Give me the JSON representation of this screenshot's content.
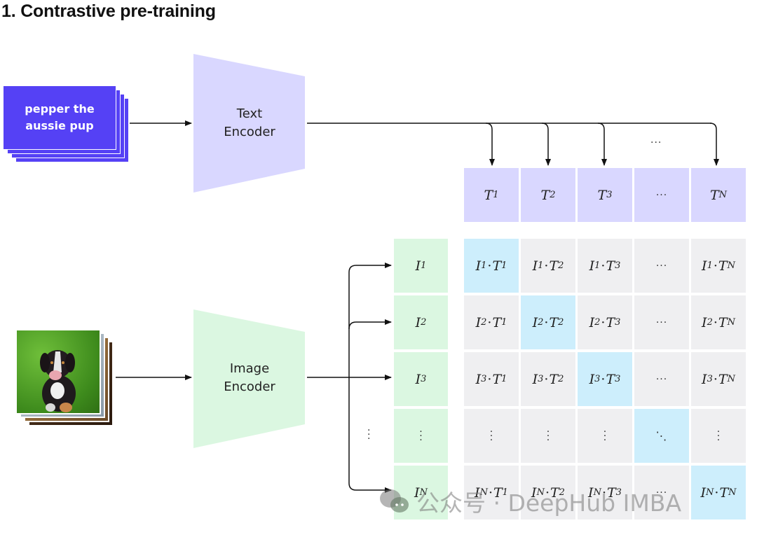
{
  "title": "1. Contrastive pre-training",
  "text_input": {
    "label_line1": "pepper the",
    "label_line2": "aussie pup"
  },
  "image_input": {
    "description": "photo of a puppy sitting on grass"
  },
  "text_encoder": {
    "line1": "Text",
    "line2": "Encoder"
  },
  "image_encoder": {
    "line1": "Image",
    "line2": "Encoder"
  },
  "text_embeddings": [
    {
      "base": "T",
      "sub": "1"
    },
    {
      "base": "T",
      "sub": "2"
    },
    {
      "base": "T",
      "sub": "3"
    },
    {
      "ellipsis": "···"
    },
    {
      "base": "T",
      "sub": "N"
    }
  ],
  "image_embeddings": [
    {
      "base": "I",
      "sub": "1"
    },
    {
      "base": "I",
      "sub": "2"
    },
    {
      "base": "I",
      "sub": "3"
    },
    {
      "vdots": true
    },
    {
      "base": "I",
      "sub": "N"
    }
  ],
  "arrow_ellipsis": "···",
  "row_ellipsis_vdots": true,
  "matrix": {
    "rows": [
      [
        {
          "i": "1",
          "t": "1",
          "diag": true
        },
        {
          "i": "1",
          "t": "2"
        },
        {
          "i": "1",
          "t": "3"
        },
        {
          "ell": "···"
        },
        {
          "i": "1",
          "t": "N"
        }
      ],
      [
        {
          "i": "2",
          "t": "1"
        },
        {
          "i": "2",
          "t": "2",
          "diag": true
        },
        {
          "i": "2",
          "t": "3"
        },
        {
          "ell": "···"
        },
        {
          "i": "2",
          "t": "N"
        }
      ],
      [
        {
          "i": "3",
          "t": "1"
        },
        {
          "i": "3",
          "t": "2"
        },
        {
          "i": "3",
          "t": "3",
          "diag": true
        },
        {
          "ell": "···"
        },
        {
          "i": "3",
          "t": "N"
        }
      ],
      [
        {
          "vd": true
        },
        {
          "vd": true
        },
        {
          "vd": true
        },
        {
          "dd": "⋱",
          "diag": true
        },
        {
          "vd": true
        }
      ],
      [
        {
          "i": "N",
          "t": "1"
        },
        {
          "i": "N",
          "t": "2"
        },
        {
          "i": "N",
          "t": "3"
        },
        {
          "ell": "···"
        },
        {
          "i": "N",
          "t": "N",
          "diag": true
        }
      ]
    ]
  },
  "colors": {
    "text_card": "#5541f5",
    "text_encoder": "#d9d7ff",
    "image_encoder": "#dbf7e1",
    "matrix_cell": "#efeff1",
    "matrix_diag": "#cdeefc"
  },
  "watermark": {
    "icon": "wechat-icon",
    "text": "公众号 · DeepHub IMBA"
  }
}
